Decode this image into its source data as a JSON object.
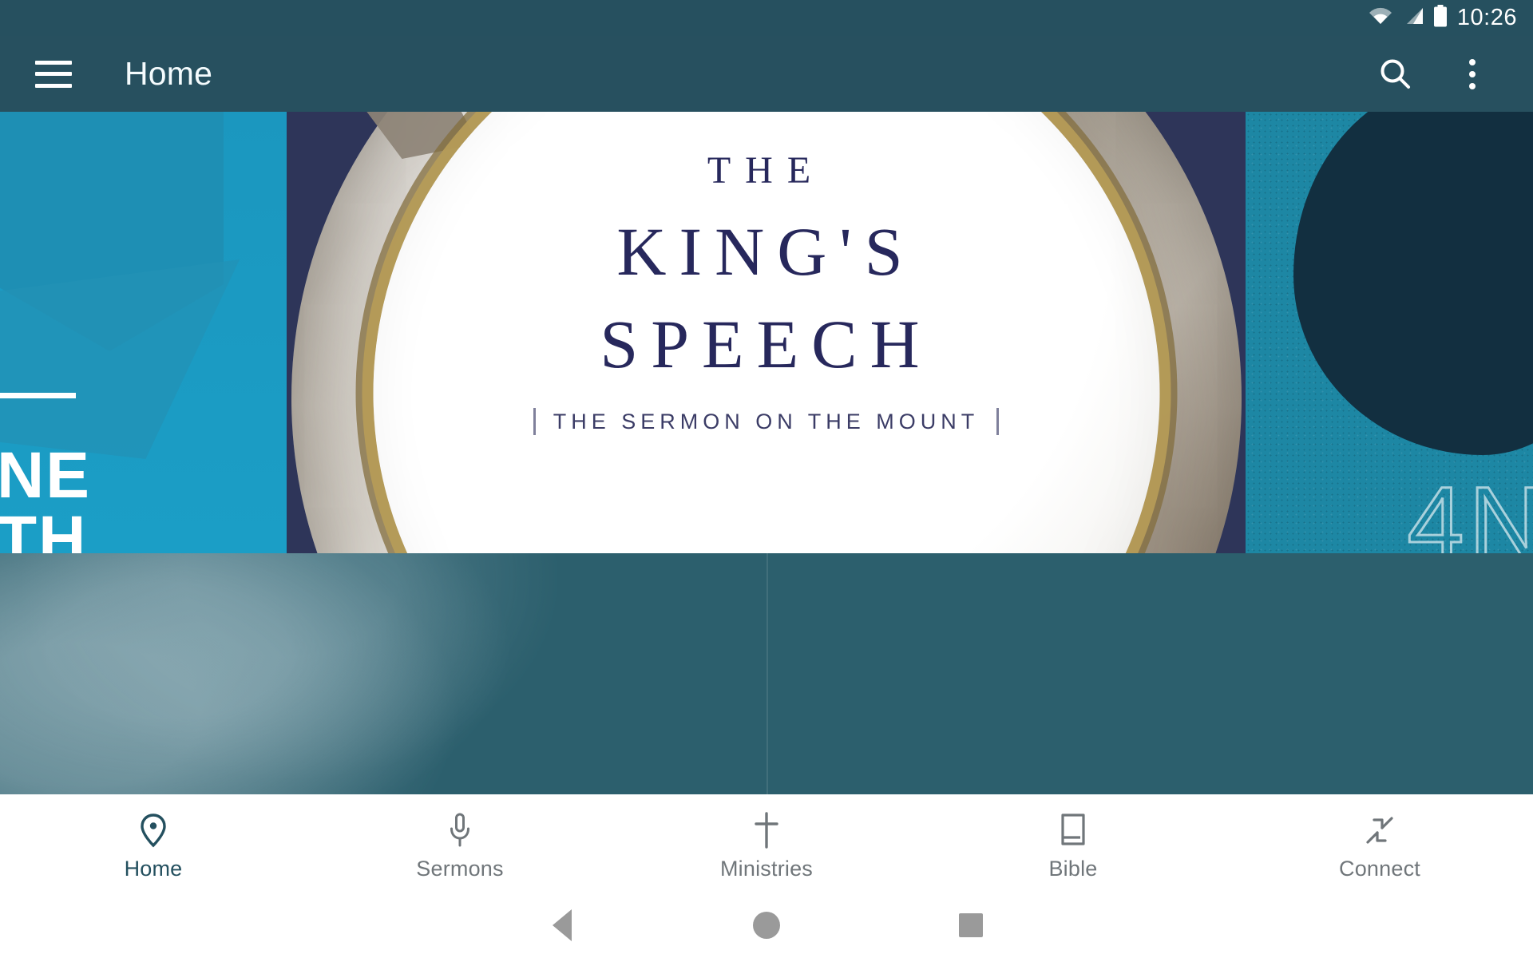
{
  "status_bar": {
    "time": "10:26",
    "icons": [
      "wifi-icon",
      "cellular-signal-icon",
      "battery-icon"
    ]
  },
  "app_bar": {
    "title": "Home",
    "menu_icon": "hamburger-menu-icon",
    "search_icon": "search-icon",
    "overflow_icon": "overflow-menu-icon",
    "background_color": "#27505f"
  },
  "carousel": {
    "active_index": 0,
    "total_slides": 4,
    "left_peek": {
      "word_line1": "NE",
      "word_line2": "TH",
      "background_color": "#1b9ec6"
    },
    "center_slide": {
      "eyebrow": "THE",
      "title_line1": "KING'S",
      "title_line2": "SPEECH",
      "subtitle": "THE SERMON ON THE MOUNT",
      "background_color": "#2e3559",
      "text_color": "#27285c"
    },
    "right_peek": {
      "partial_text": "4N",
      "background_color": "#1d87a4"
    }
  },
  "bottom_nav": {
    "active": "Home",
    "active_color": "#24505f",
    "inactive_color": "#70767a",
    "items": [
      {
        "label": "Home",
        "icon": "location-pin-icon"
      },
      {
        "label": "Sermons",
        "icon": "microphone-icon"
      },
      {
        "label": "Ministries",
        "icon": "cross-icon"
      },
      {
        "label": "Bible",
        "icon": "book-icon"
      },
      {
        "label": "Connect",
        "icon": "collapse-arrows-icon"
      }
    ]
  },
  "system_nav": {
    "back": "back-button",
    "home": "home-button",
    "recents": "recents-button"
  }
}
